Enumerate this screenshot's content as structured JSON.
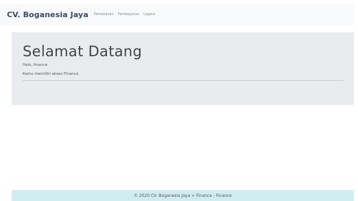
{
  "navbar": {
    "brand": "CV. Boganesia Jaya",
    "links": [
      "Pemesanan",
      "Pembayaran",
      "Logout"
    ]
  },
  "jumbotron": {
    "title": "Selamat Datang",
    "greeting": "Halo, finance",
    "access": "Kamu memiliki akses Finance."
  },
  "footer": {
    "text": "© 2020 CV. Boganesia Jaya > Finance - Finance"
  },
  "colors": {
    "navbar_bg": "#f8f9fa",
    "jumbotron_bg": "#e9ecef",
    "footer_bg": "#d1ecf1"
  }
}
